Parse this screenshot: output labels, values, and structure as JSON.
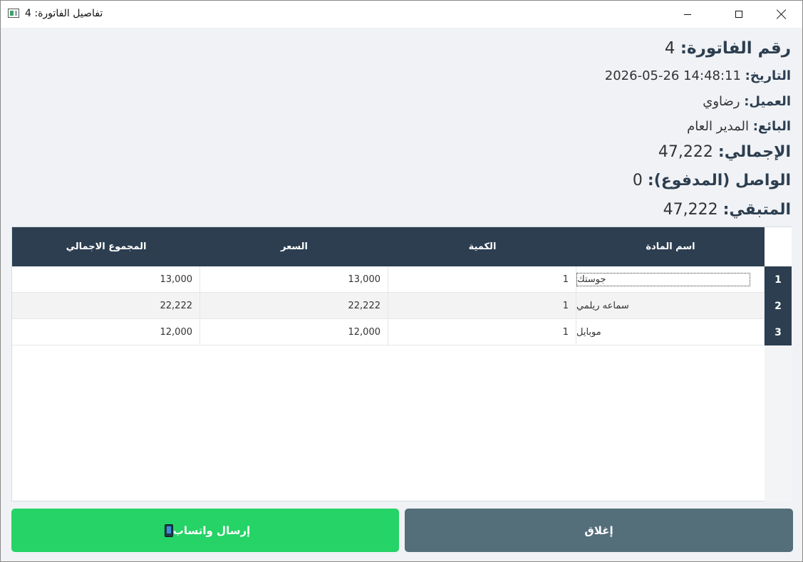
{
  "window": {
    "title": "تفاصيل الفاتورة: 4"
  },
  "invoice": {
    "number_label": "رقم الفاتورة:",
    "number_value": "4",
    "date_label": "التاريخ:",
    "date_value": "2026-05-26 14:48:11",
    "customer_label": "العميل:",
    "customer_value": "رضاوي",
    "seller_label": "البائع:",
    "seller_value": "المدير العام",
    "total_label": "الإجمالي:",
    "total_value": "47,222",
    "paid_label": "الواصل (المدفوع):",
    "paid_value": "0",
    "remaining_label": "المتبقي:",
    "remaining_value": "47,222"
  },
  "table": {
    "headers": {
      "item_name": "اسم المادة",
      "quantity": "الكمية",
      "price": "السعر",
      "line_total": "المجموع الاجمالي"
    },
    "rows": [
      {
        "row_number": "1",
        "item_name": "جوستك",
        "quantity": "1",
        "price": "13,000",
        "line_total": "13,000"
      },
      {
        "row_number": "2",
        "item_name": "سماعه ريلمي",
        "quantity": "1",
        "price": "22,222",
        "line_total": "22,222"
      },
      {
        "row_number": "3",
        "item_name": "موبايل",
        "quantity": "1",
        "price": "12,000",
        "line_total": "12,000"
      }
    ]
  },
  "buttons": {
    "whatsapp_label": "إرسال واتساب",
    "close_label": "إغلاق"
  },
  "colors": {
    "header_bg": "#2c3e50",
    "whatsapp_green": "#25d366",
    "close_gray": "#546e7a"
  },
  "icons": [
    "window-app-icon",
    "minimize-icon",
    "maximize-icon",
    "close-icon",
    "mobile-phone-icon"
  ]
}
